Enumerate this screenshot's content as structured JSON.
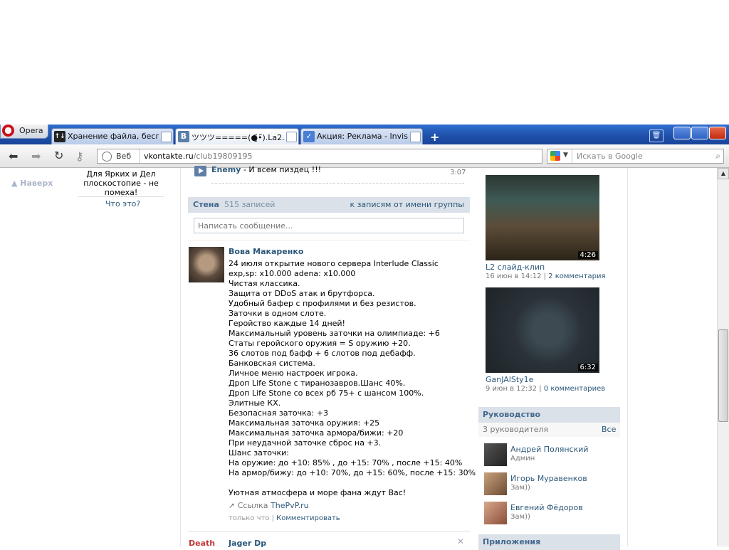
{
  "browser": {
    "menu_label": "Opera",
    "tabs": [
      {
        "title": "Хранение файла, беспл...",
        "icon": "upload-site-icon"
      },
      {
        "title": "ツツツ=====(●̮̮̃•̃).La2...",
        "icon": "vk-icon",
        "icon_text": "В"
      },
      {
        "title": "Акция: Реклама - Invisi...",
        "icon": "check-site-icon"
      }
    ],
    "new_tab": "+",
    "address": {
      "mode": "Веб",
      "url_host": "vkontakte.ru",
      "url_path": "/club19809195"
    },
    "search_placeholder": "Искать в Google"
  },
  "left": {
    "back_to_top": "Наверх",
    "note": "Для Ярких и Дел плоскостопие - не помеха!",
    "what_is": "Что это?"
  },
  "audio": {
    "artist": "Enemy",
    "title": " - И всем пиздец !!!",
    "duration": "3:07"
  },
  "wall": {
    "title": "Стена",
    "count": "515 записей",
    "group_posts_link": "к записям от имени группы",
    "compose_placeholder": "Написать сообщение...",
    "posts": [
      {
        "author": "Вова Макаренко",
        "lines": [
          "24 июля открытие нового сервера Interlude Classic",
          "exp,sp: x10.000 adena: x10.000",
          "Чистая классика.",
          "Защита от DDoS атак и брутфорса.",
          "Удобный бафер с профилями и без резистов.",
          "Заточки в одном слоте.",
          "Геройство каждые 14 дней!",
          "Максимальный уровень заточки на олимпиаде: +6",
          "Статы геройского оружия = S оружию +20.",
          "36 слотов под бафф + 6 слотов под дебафф.",
          "Банковская система.",
          "Личное меню настроек игрока.",
          "Дроп Life Stone с тиранозавров.Шанс 40%.",
          "Дроп Life Stone со всех рб 75+ с шансом 100%.",
          "Элитные КХ.",
          "Безопасная заточка: +3",
          "Максимальная заточка оружия: +25",
          "Максимальная заточка армора/бижи: +20",
          "При неудачной заточке сброс на +3.",
          "Шанс заточки:",
          "На оружие: до +10: 85% , до +15: 70% , после +15: 40%",
          "На армор/бижу: до +10: 70%, до +15: 60%, после +15: 30%",
          "",
          "Уютная атмосфера и море фана ждут Вас!"
        ],
        "link_label": "Ссылка",
        "link_text": "ThePvP.ru",
        "time": "только что",
        "comment": "Комментировать"
      },
      {
        "author": "Jager Dp",
        "avatar_text": "Death"
      }
    ]
  },
  "videos": [
    {
      "title": "L2 слайд-клип",
      "duration": "4:26",
      "date": "16 июн в 14:12",
      "comments": "2 комментария"
    },
    {
      "title": "GanJAlSty1e",
      "duration": "6:32",
      "date": "9 июн в 12:32",
      "comments": "0 комментариев"
    }
  ],
  "managers": {
    "title": "Руководство",
    "count": "3 руководителя",
    "all": "Все",
    "items": [
      {
        "name": "Андрей Полянский",
        "role": "Админ"
      },
      {
        "name": "Игорь Муравенков",
        "role": "Зам))"
      },
      {
        "name": "Евгений Фёдоров",
        "role": "Зам))"
      }
    ]
  },
  "apps": {
    "title": "Приложения"
  }
}
